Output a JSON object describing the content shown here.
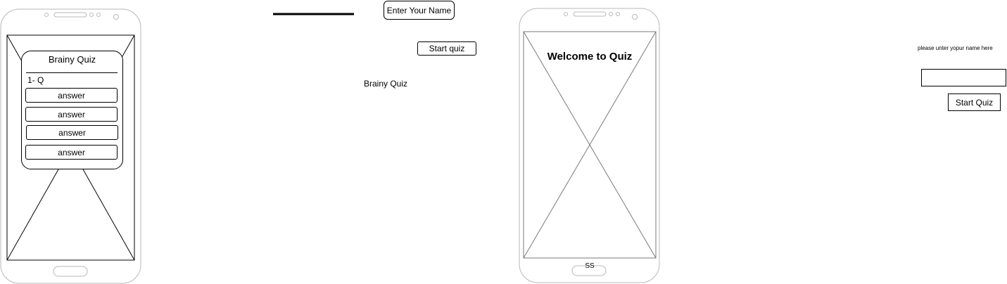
{
  "phone1": {
    "card_title": "Brainy Quiz",
    "question": "1- Q",
    "answers": [
      "answer",
      "answer",
      "answer",
      "answer"
    ]
  },
  "floating": {
    "name_button": "Enter Your Name",
    "start_button": "Start quiz",
    "brand_label": "Brainy Quiz"
  },
  "phone2": {
    "welcome": "Welcome to Quiz",
    "footer": "SS"
  },
  "right_form": {
    "hint": "please unter yopur name here",
    "start_button": "Start Quiz"
  }
}
